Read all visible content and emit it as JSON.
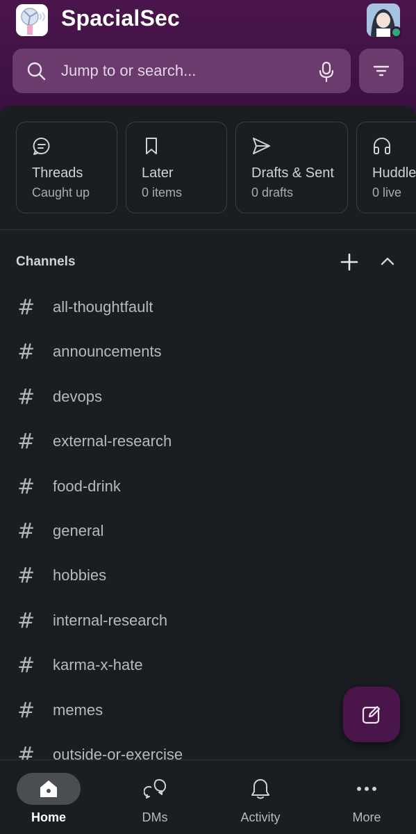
{
  "workspace": {
    "name": "SpacialSec"
  },
  "search": {
    "placeholder": "Jump to or search..."
  },
  "colors": {
    "brand": "#4a154b",
    "background": "#1a1d21",
    "presence": "#2bac76"
  },
  "quick_cards": [
    {
      "icon": "threads-icon",
      "title": "Threads",
      "subtitle": "Caught up"
    },
    {
      "icon": "bookmark-icon",
      "title": "Later",
      "subtitle": "0 items"
    },
    {
      "icon": "send-icon",
      "title": "Drafts & Sent",
      "subtitle": "0 drafts"
    },
    {
      "icon": "headphones-icon",
      "title": "Huddles",
      "subtitle": "0 live"
    }
  ],
  "channels": {
    "header": "Channels",
    "items": [
      "all-thoughtfault",
      "announcements",
      "devops",
      "external-research",
      "food-drink",
      "general",
      "hobbies",
      "internal-research",
      "karma-x-hate",
      "memes",
      "outside-or-exercise"
    ]
  },
  "nav": [
    {
      "label": "Home",
      "icon": "home-icon",
      "active": true
    },
    {
      "label": "DMs",
      "icon": "dms-icon",
      "active": false
    },
    {
      "label": "Activity",
      "icon": "bell-icon",
      "active": false
    },
    {
      "label": "More",
      "icon": "more-icon",
      "active": false
    }
  ]
}
